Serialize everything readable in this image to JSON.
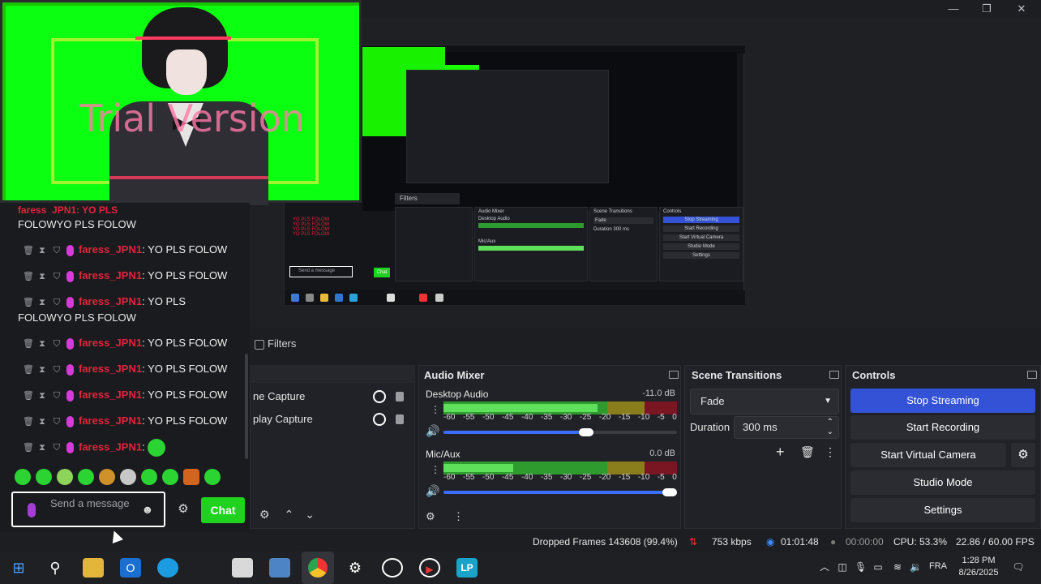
{
  "window": {
    "minimize": "—",
    "maximize": "❐",
    "close": "✕"
  },
  "overlay": {
    "watermark": "Trial Version"
  },
  "chat": {
    "messages": [
      {
        "user": "faress_JPN1",
        "text": "YO PLS FOLOW"
      },
      {
        "user": "faress_JPN1",
        "text": "YO PLS FOLOW"
      },
      {
        "user": "faress_JPN1",
        "text": "YO PLS FOLOW"
      },
      {
        "user": "faress_JPN1",
        "text": "YO PLS FOLOW"
      },
      {
        "user": "faress_JPN1",
        "text": "YO PLS FOLOW"
      },
      {
        "user": "faress_JPN1",
        "text": "YO PLS FOLOW"
      }
    ],
    "wrap_top": "FOLOWYO PLS FOLOW",
    "partial_user": "faress_JPN1",
    "partial_text": "YO PLS",
    "wrap_mid": "FOLOWYO PLS FOLOW",
    "top_partial": "faress_JPN1: YO PLS",
    "last_user": "faress_JPN1",
    "colon": ":",
    "input_placeholder": "Send a message",
    "chat_button": "Chat"
  },
  "sources": {
    "filters_tab": "Filters",
    "items": [
      {
        "label": "ne Capture"
      },
      {
        "label": "play Capture"
      }
    ]
  },
  "audio_mixer": {
    "title": "Audio Mixer",
    "channels": [
      {
        "name": "Desktop Audio",
        "db": "-11.0 dB",
        "level": 0.66,
        "volume": 0.62
      },
      {
        "name": "Mic/Aux",
        "db": "0.0 dB",
        "level": 0.3,
        "volume": 1.0
      }
    ],
    "ticks": [
      "-60",
      "-55",
      "-50",
      "-45",
      "-40",
      "-35",
      "-30",
      "-25",
      "-20",
      "-15",
      "-10",
      "-5",
      "0"
    ]
  },
  "scene_transitions": {
    "title": "Scene Transitions",
    "transition": "Fade",
    "duration_label": "Duration",
    "duration_value": "300 ms"
  },
  "controls": {
    "title": "Controls",
    "stop_streaming": "Stop Streaming",
    "start_recording": "Start Recording",
    "start_virtual_camera": "Start Virtual Camera",
    "studio_mode": "Studio Mode",
    "settings": "Settings"
  },
  "status": {
    "dropped_frames": "Dropped Frames 143608 (99.4%)",
    "bitrate": "753 kbps",
    "stream_time": "01:01:48",
    "rec_time": "00:00:00",
    "cpu": "CPU: 53.3%",
    "fps": "22.86 / 60.00 FPS"
  },
  "taskbar": {
    "language": "FRA",
    "time": "1:28 PM",
    "date": "8/26/2025"
  },
  "nested": {
    "filters": "Filters",
    "audio_mixer": "Audio Mixer",
    "scene_transitions": "Scene Transitions",
    "controls": "Controls",
    "stop_streaming": "Stop Streaming",
    "start_recording": "Start Recording",
    "start_virtual_camera": "Start Virtual Camera",
    "studio_mode": "Studio Mode",
    "settings": "Settings",
    "desktop_audio": "Desktop Audio",
    "mic_aux": "Mic/Aux",
    "fade": "Fade",
    "duration": "Duration",
    "duration_value": "300 ms",
    "chat_line": "YO PLS FOLOW",
    "chat_button": "Chat",
    "send_message": "Send a message"
  }
}
